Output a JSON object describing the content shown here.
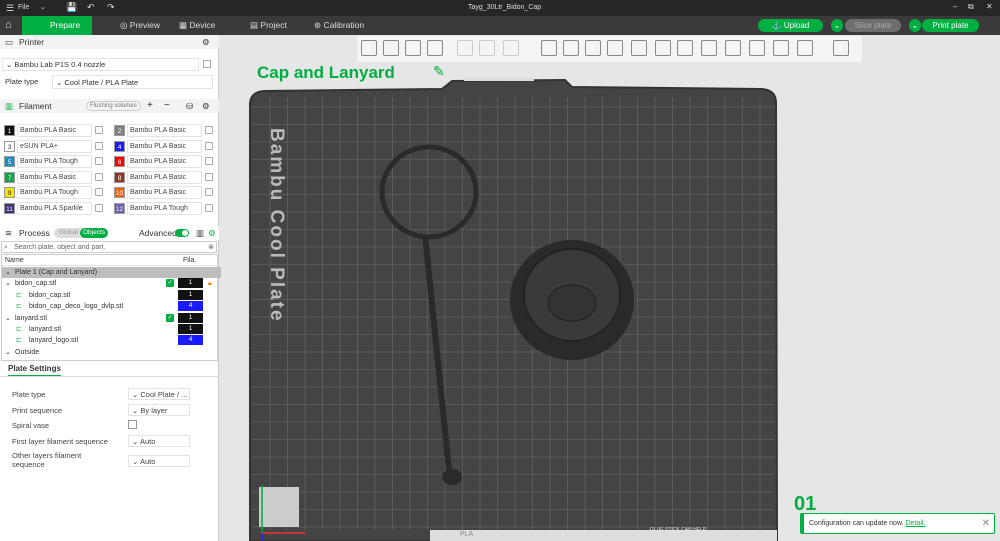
{
  "titlebar": {
    "menu_label": "File",
    "document_title": "Tayg_30Ltr_Bidon_Cap"
  },
  "tabs": [
    {
      "label": "Prepare",
      "active": true
    },
    {
      "label": "Preview"
    },
    {
      "label": "Device"
    },
    {
      "label": "Project"
    },
    {
      "label": "Calibration"
    }
  ],
  "actions": {
    "upload": "Upload",
    "slice": "Slice plate",
    "print": "Print plate"
  },
  "printer": {
    "section": "Printer",
    "preset": "Bambu Lab P1S 0.4 nozzle",
    "plate_type_label": "Plate type",
    "plate_type": "Cool Plate / PLA Plate"
  },
  "filament": {
    "section": "Filament",
    "flushing": "Flushing volumes",
    "items": [
      {
        "n": "1",
        "name": "Bambu PLA Basic",
        "color": "#111111"
      },
      {
        "n": "2",
        "name": "Bambu PLA Basic",
        "color": "#808080"
      },
      {
        "n": "3",
        "name": "eSUN PLA+",
        "color": "#ffffff"
      },
      {
        "n": "4",
        "name": "Bambu PLA Basic",
        "color": "#1a1aff"
      },
      {
        "n": "5",
        "name": "Bambu PLA Tough",
        "color": "#1a8fc0"
      },
      {
        "n": "6",
        "name": "Bambu PLA Basic",
        "color": "#ff0000"
      },
      {
        "n": "7",
        "name": "Bambu PLA Basic",
        "color": "#16a34a"
      },
      {
        "n": "8",
        "name": "Bambu PLA Basic",
        "color": "#8b3a2a"
      },
      {
        "n": "9",
        "name": "Bambu PLA Tough",
        "color": "#f5e000"
      },
      {
        "n": "10",
        "name": "Bambu PLA Basic",
        "color": "#f06010"
      },
      {
        "n": "11",
        "name": "Bambu PLA Sparkle",
        "color": "#40307a"
      },
      {
        "n": "12",
        "name": "Bambu PLA Tough",
        "color": "#6a60b0"
      }
    ]
  },
  "process": {
    "section": "Process",
    "global": "Global",
    "objects": "Objects",
    "advanced": "Advanced"
  },
  "objects": {
    "search_placeholder": "Search plate, object and part.",
    "col_name": "Name",
    "col_fila": "Fila.",
    "rows": [
      {
        "name": "Plate 1 (Cap and Lanyard)",
        "level": 0,
        "plate": true
      },
      {
        "name": "bidon_cap.stl",
        "level": 1,
        "fila": "1",
        "check": true,
        "lock": true
      },
      {
        "name": "bidon_cap.stl",
        "level": 2,
        "fila": "1"
      },
      {
        "name": "bidon_cap_deco_logo_dvlp.stl",
        "level": 2,
        "fila": "4",
        "blue": true
      },
      {
        "name": "lanyard.stl",
        "level": 1,
        "fila": "1",
        "check": true
      },
      {
        "name": "lanyard.stl",
        "level": 2,
        "fila": "1"
      },
      {
        "name": "lanyard_logo.stl",
        "level": 2,
        "fila": "4",
        "blue": true
      },
      {
        "name": "Outside",
        "level": 0
      }
    ]
  },
  "plate_settings": {
    "tab": "Plate Settings",
    "rows": [
      {
        "label": "Plate type",
        "value": "Cool Plate / ..."
      },
      {
        "label": "Print sequence",
        "value": "By layer"
      },
      {
        "label": "Spiral vase",
        "checkbox": true
      },
      {
        "label": "First layer filament sequence",
        "value": "Auto"
      },
      {
        "label": "Other layers filament sequence",
        "value": "Auto"
      }
    ]
  },
  "viewport": {
    "plate_name": "Cap and Lanyard",
    "bed_label": "Bambu Cool Plate",
    "plate_number": "01",
    "bed_footer": "PLA",
    "glue_text": "GLUE STICK CAN HELP."
  },
  "notification": {
    "text": "Configuration can update now.",
    "link": "Detail."
  },
  "colors": {
    "accent": "#00ae42"
  }
}
